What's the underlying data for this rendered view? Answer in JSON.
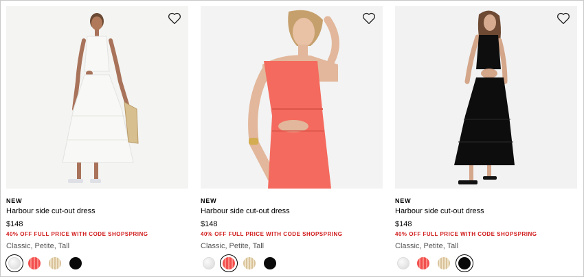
{
  "products": [
    {
      "badge": "NEW",
      "name": "Harbour side cut-out dress",
      "price": "$148",
      "promo": "40% OFF FULL PRICE WITH CODE SHOPSPRING",
      "sizes": "Classic, Petite, Tall",
      "selected_color": "white",
      "photo_color": "#f4f4f2",
      "dress_color": "#f7f7f5",
      "wishlist_icon": "heart-outline-icon"
    },
    {
      "badge": "NEW",
      "name": "Harbour side cut-out dress",
      "price": "$148",
      "promo": "40% OFF FULL PRICE WITH CODE SHOPSPRING",
      "sizes": "Classic, Petite, Tall",
      "selected_color": "coral",
      "photo_color": "#f3f3f3",
      "dress_color": "#f46a5e",
      "wishlist_icon": "heart-outline-icon"
    },
    {
      "badge": "NEW",
      "name": "Harbour side cut-out dress",
      "price": "$148",
      "promo": "40% OFF FULL PRICE WITH CODE SHOPSPRING",
      "sizes": "Classic, Petite, Tall",
      "selected_color": "black",
      "photo_color": "#f2f2f2",
      "dress_color": "#0d0d0d",
      "wishlist_icon": "heart-outline-icon"
    }
  ],
  "swatch_colors": [
    "white",
    "coral",
    "tan",
    "black"
  ],
  "colors": {
    "promo": "#d11a1a",
    "text": "#000000",
    "muted": "#555555"
  }
}
